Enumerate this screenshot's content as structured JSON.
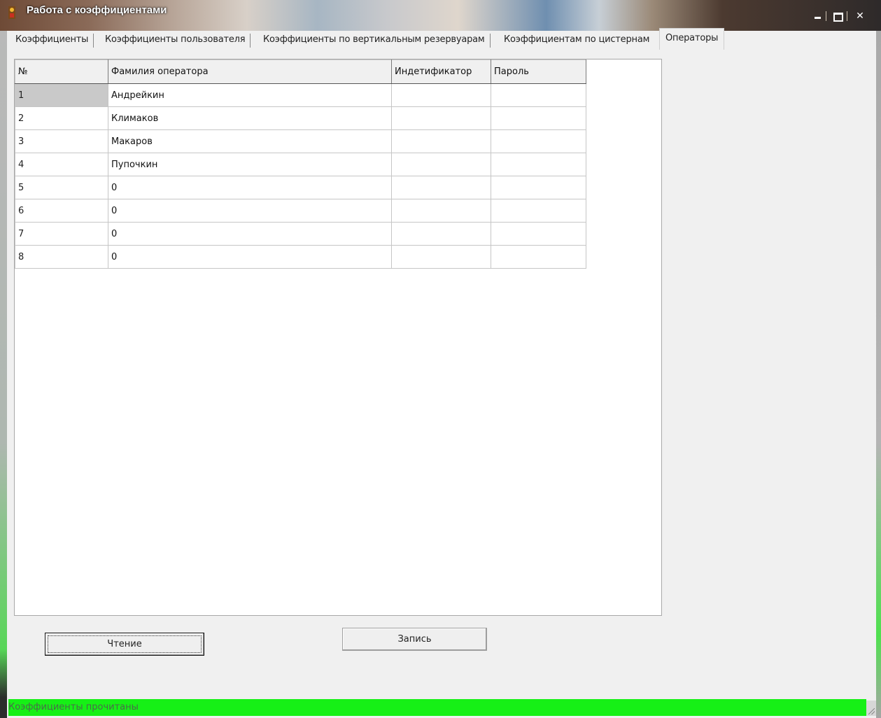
{
  "window": {
    "title": "Работа с коэффициентами"
  },
  "tabs": [
    {
      "label": "Коэффициенты"
    },
    {
      "label": "Коэффициенты пользователя"
    },
    {
      "label": "Коэффициенты по вертикальным резервуарам"
    },
    {
      "label": "Коэффициентам по цистернам"
    },
    {
      "label": "Операторы",
      "active": true
    }
  ],
  "grid": {
    "columns": [
      "№",
      "Фамилия оператора",
      "Индетификатор",
      "Пароль"
    ],
    "rows": [
      {
        "num": "1",
        "name": "Андрейкин",
        "id": "",
        "password": ""
      },
      {
        "num": "2",
        "name": "Климаков",
        "id": "",
        "password": ""
      },
      {
        "num": "3",
        "name": "Макаров",
        "id": "",
        "password": ""
      },
      {
        "num": "4",
        "name": "Пупочкин",
        "id": "",
        "password": ""
      },
      {
        "num": "5",
        "name": "0",
        "id": "",
        "password": ""
      },
      {
        "num": "6",
        "name": "0",
        "id": "",
        "password": ""
      },
      {
        "num": "7",
        "name": "0",
        "id": "",
        "password": ""
      },
      {
        "num": "8",
        "name": "0",
        "id": "",
        "password": ""
      }
    ]
  },
  "buttons": {
    "read_label": "Чтение",
    "write_label": "Запись"
  },
  "status": {
    "text": "Коэффициенты прочитаны",
    "color": "#16f016"
  },
  "icons": {
    "app": "app-icon",
    "minimize": "minimize-icon",
    "maximize": "maximize-icon",
    "close": "close-icon"
  }
}
